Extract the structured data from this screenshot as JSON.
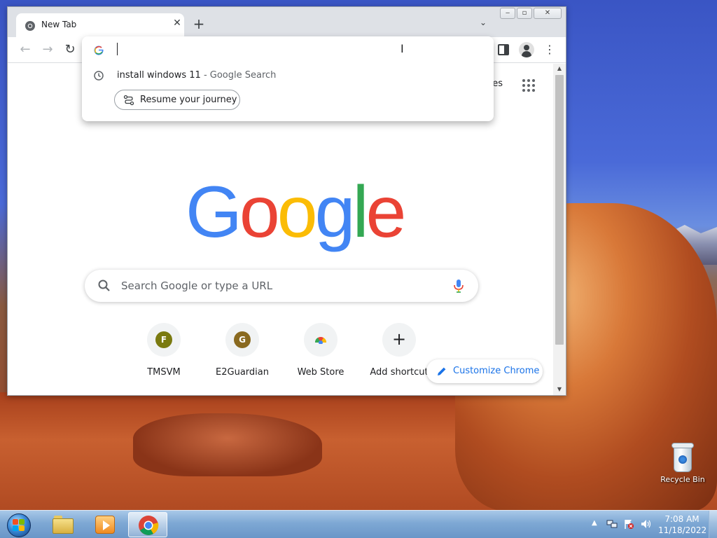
{
  "desktop": {
    "recycle_bin_label": "Recycle Bin"
  },
  "browser": {
    "tab": {
      "title": "New Tab",
      "icon": "chrome-icon"
    },
    "new_tab_label": "+",
    "toolbar_icons": [
      "back-arrow",
      "forward-arrow",
      "reload",
      "side-panel",
      "profile",
      "more-menu"
    ],
    "omnibox": {
      "value": "",
      "suggestion": {
        "query": "install windows 11",
        "separator": " - ",
        "source": "Google Search",
        "icon": "history-clock-icon"
      },
      "journey_chip": "Resume your journey"
    },
    "ntp": {
      "images_link": "ges",
      "logo_text": [
        "G",
        "o",
        "o",
        "g",
        "l",
        "e"
      ],
      "search_placeholder": "Search Google or type a URL",
      "shortcuts": [
        {
          "label": "TMSVM",
          "letter": "F",
          "color": "#7a7a10"
        },
        {
          "label": "E2Guardian",
          "letter": "G",
          "color": "#8a6a20"
        },
        {
          "label": "Web Store",
          "icon": "webstore-icon"
        },
        {
          "label": "Add shortcut",
          "icon": "plus-icon"
        }
      ],
      "customize_label": "Customize Chrome"
    }
  },
  "taskbar": {
    "clock_time": "7:08 AM",
    "clock_date": "11/18/2022",
    "pinned": [
      "windows-explorer",
      "windows-media-player",
      "google-chrome"
    ]
  },
  "colors": {
    "google_blue": "#4285f4",
    "google_red": "#ea4335",
    "google_yellow": "#fbbc05",
    "google_green": "#34a853",
    "link_blue": "#1a73e8"
  }
}
